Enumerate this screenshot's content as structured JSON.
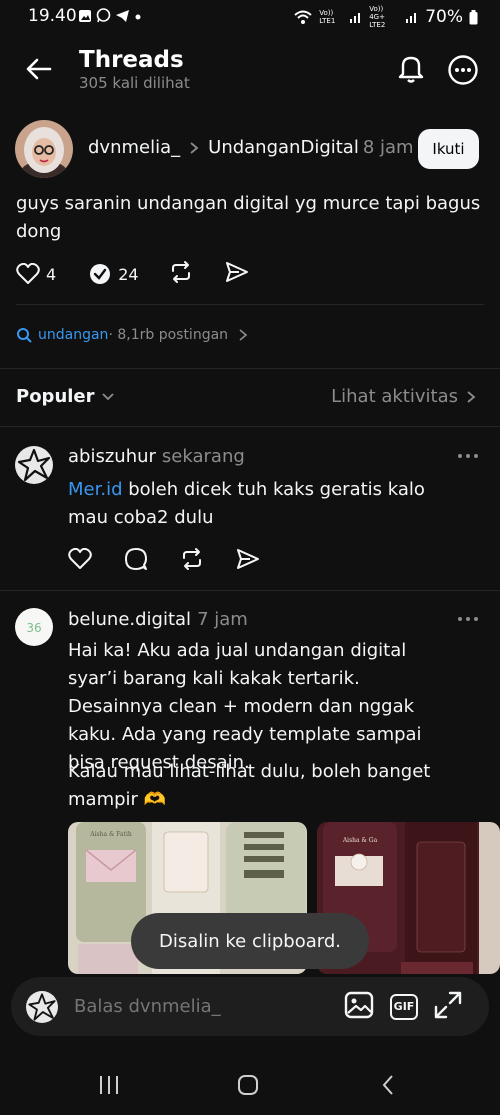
{
  "status_bar": {
    "time": "19.40",
    "network_1": "Vo)) LTE1",
    "network_2": "Vo)) 4G+ LTE2",
    "battery": "70%"
  },
  "header": {
    "title": "Threads",
    "subtitle": "305 kali dilihat"
  },
  "post": {
    "username": "dvnmelia_",
    "topic": "UndanganDigital",
    "time": "8 jam",
    "follow_label": "Ikuti",
    "text": "guys saranin undangan digital yg murce tapi bagus dong",
    "likes": "4",
    "replies": "24"
  },
  "topic_row": {
    "tag": "undangan",
    "count": "· 8,1rb postingan"
  },
  "sort_bar": {
    "sort_label": "Populer",
    "activity_label": "Lihat aktivitas"
  },
  "replies": [
    {
      "username": "abiszuhur",
      "time": "sekarang",
      "link": "Mer.id",
      "text": " boleh dicek tuh kaks geratis kalo mau coba2 dulu"
    },
    {
      "username": "belune.digital",
      "time": "7 jam",
      "paragraph_1": "Hai ka! Aku ada jual undangan digital syar’i barang kali kakak tertarik. Desainnya clean + modern dan nggak kaku. Ada yang ready template sampai bisa request desain.",
      "paragraph_2": "Kalau mau lihat-lihat dulu, boleh banget mampir 🫶",
      "thumb_1_caption": "Aisha & Fatih",
      "thumb_2_caption": "Aisha & Ga"
    }
  ],
  "toast": "Disalin ke clipboard.",
  "reply_bar": {
    "placeholder": "Balas dvnmelia_",
    "gif_label": "GIF"
  },
  "colors": {
    "background": "#101010",
    "link_blue": "#3897f0",
    "muted": "#8c8c8c",
    "divider": "#262626"
  }
}
